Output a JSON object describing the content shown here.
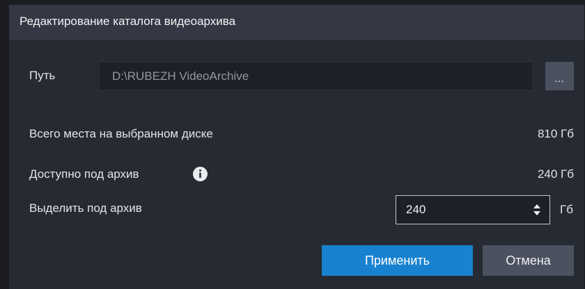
{
  "dialog": {
    "title": "Редактирование каталога видеоархива"
  },
  "path": {
    "label": "Путь",
    "value": "D:\\RUBEZH VideoArchive",
    "browse_label": "..."
  },
  "stats": {
    "total_label": "Всего места на выбранном диске",
    "total_value": "810 Гб",
    "available_label": "Доступно под архив",
    "available_value": "240 Гб",
    "info_icon": "info-icon"
  },
  "allocate": {
    "label": "Выделить под архив",
    "value": "240",
    "unit": "Гб"
  },
  "buttons": {
    "apply_label": "Применить",
    "cancel_label": "Отмена"
  },
  "colors": {
    "accent": "#1882d0",
    "dialog_bg": "#262a33",
    "titlebar_bg": "#333844"
  }
}
